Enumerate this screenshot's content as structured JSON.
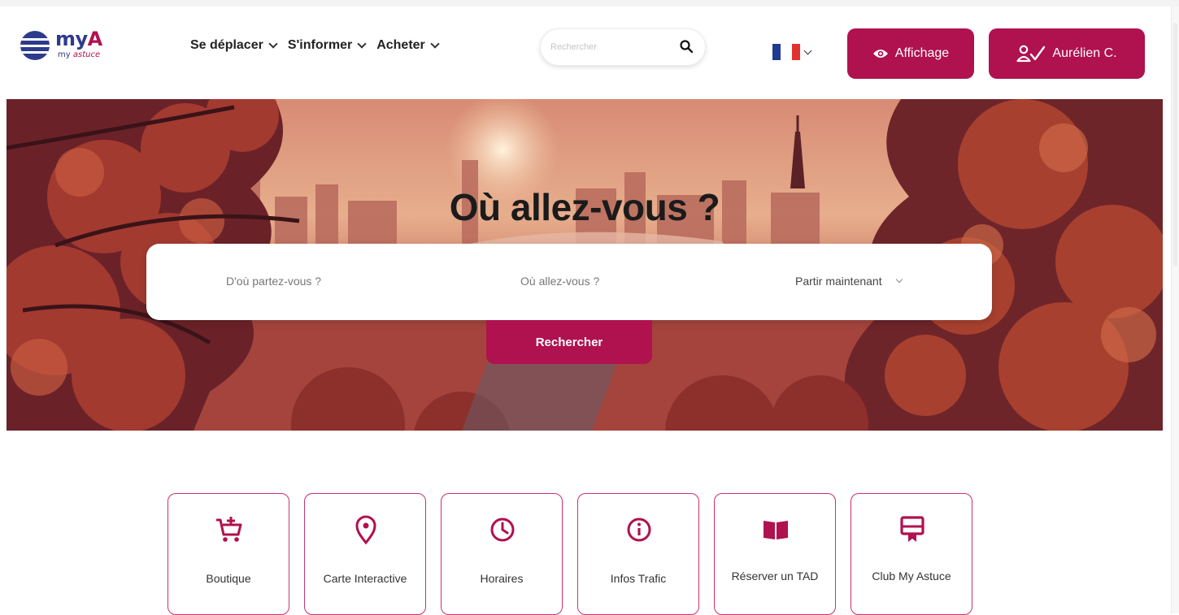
{
  "brand": {
    "logo_word": "my",
    "logo_letter": "A",
    "logo_sub_1": "my",
    "logo_sub_2": "astuce",
    "colors": {
      "primary": "#b0114f",
      "navy": "#2e3b8c"
    }
  },
  "nav": {
    "items": [
      {
        "label": "Se déplacer"
      },
      {
        "label": "S'informer"
      },
      {
        "label": "Acheter"
      }
    ]
  },
  "search": {
    "placeholder": "Rechercher",
    "icon": "search-icon"
  },
  "language": {
    "current": "fr",
    "flag_colors": [
      "#1f3a93",
      "#ffffff",
      "#e0322f"
    ]
  },
  "actions": {
    "display_label": "Affichage",
    "user_label": "Aurélien C."
  },
  "hero": {
    "title": "Où allez-vous ?",
    "from_placeholder": "D'où partez-vous ?",
    "to_placeholder": "Où allez-vous ?",
    "time_label": "Partir maintenant",
    "search_button": "Rechercher"
  },
  "tiles": [
    {
      "label": "Boutique",
      "icon": "cart-plus-icon"
    },
    {
      "label": "Carte Interactive",
      "icon": "map-pin-icon"
    },
    {
      "label": "Horaires",
      "icon": "clock-icon"
    },
    {
      "label": "Infos Trafic",
      "icon": "info-icon"
    },
    {
      "label": "Réserver un TAD",
      "icon": "book-icon"
    },
    {
      "label": "Club My Astuce",
      "icon": "membership-card-icon"
    }
  ]
}
